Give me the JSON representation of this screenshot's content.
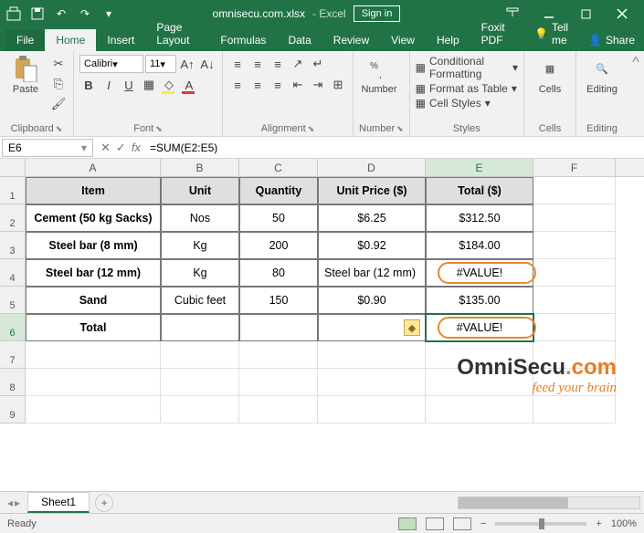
{
  "title": {
    "document": "omnisecu.com.xlsx",
    "app": "Excel",
    "signin": "Sign in"
  },
  "tabs": [
    "File",
    "Home",
    "Insert",
    "Page Layout",
    "Formulas",
    "Data",
    "Review",
    "View",
    "Help",
    "Foxit PDF"
  ],
  "tellme": "Tell me",
  "share": "Share",
  "ribbon": {
    "clipboard": {
      "paste": "Paste",
      "label": "Clipboard"
    },
    "font": {
      "name": "Calibri",
      "size": "11",
      "label": "Font"
    },
    "alignment": {
      "label": "Alignment"
    },
    "number": {
      "paste": "Number",
      "label": "Number"
    },
    "styles": {
      "cond": "Conditional Formatting",
      "table": "Format as Table",
      "cell": "Cell Styles",
      "label": "Styles"
    },
    "cells": {
      "paste": "Cells",
      "label": "Cells"
    },
    "editing": {
      "paste": "Editing",
      "label": "Editing"
    }
  },
  "namebox": "E6",
  "formula": "=SUM(E2:E5)",
  "columns": [
    "A",
    "B",
    "C",
    "D",
    "E",
    "F"
  ],
  "rows": [
    "1",
    "2",
    "3",
    "4",
    "5",
    "6",
    "7",
    "8",
    "9"
  ],
  "grid": {
    "header": [
      "Item",
      "Unit",
      "Quantity",
      "Unit Price ($)",
      "Total ($)"
    ],
    "data": [
      [
        "Cement (50 kg Sacks)",
        "Nos",
        "50",
        "$6.25",
        "$312.50"
      ],
      [
        "Steel bar (8 mm)",
        "Kg",
        "200",
        "$0.92",
        "$184.00"
      ],
      [
        "Steel bar (12 mm)",
        "Kg",
        "80",
        "Steel bar (12 mm)",
        "#VALUE!"
      ],
      [
        "Sand",
        "Cubic feet",
        "150",
        "$0.90",
        "$135.00"
      ],
      [
        "Total",
        "",
        "",
        "",
        "#VALUE!"
      ]
    ]
  },
  "sheet": "Sheet1",
  "status": "Ready",
  "zoom": "100%",
  "logo": {
    "name1": "OmniSecu",
    "name2": ".com",
    "tag": "feed your brain"
  }
}
